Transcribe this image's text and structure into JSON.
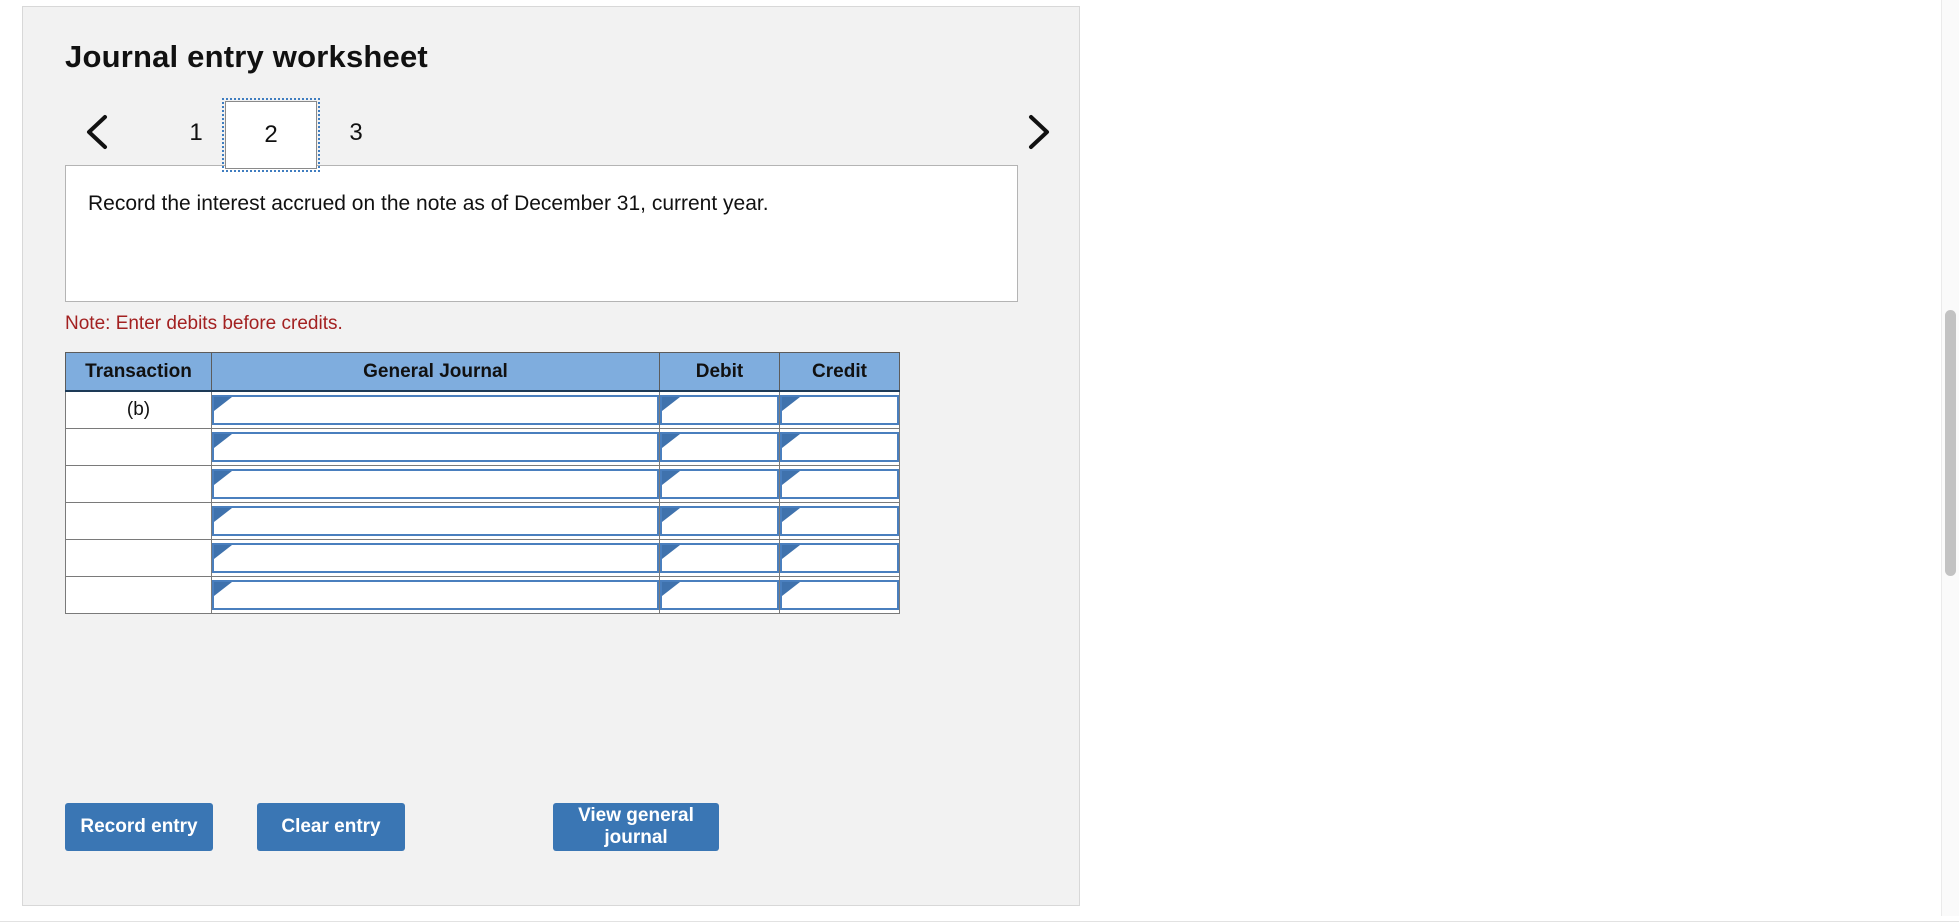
{
  "worksheet": {
    "title": "Journal entry worksheet",
    "description": "Record the interest accrued on the note as of December 31, current year.",
    "note": "Note: Enter debits before credits."
  },
  "pager": {
    "prev_icon": "chevron-left-icon",
    "next_icon": "chevron-right-icon",
    "tabs": [
      {
        "label": "1",
        "selected": false
      },
      {
        "label": "2",
        "selected": true
      },
      {
        "label": "3",
        "selected": false
      }
    ]
  },
  "table": {
    "headers": {
      "transaction": "Transaction",
      "general_journal": "General Journal",
      "debit": "Debit",
      "credit": "Credit"
    },
    "rows": [
      {
        "transaction": "(b)",
        "general_journal": "",
        "debit": "",
        "credit": ""
      },
      {
        "transaction": "",
        "general_journal": "",
        "debit": "",
        "credit": ""
      },
      {
        "transaction": "",
        "general_journal": "",
        "debit": "",
        "credit": ""
      },
      {
        "transaction": "",
        "general_journal": "",
        "debit": "",
        "credit": ""
      },
      {
        "transaction": "",
        "general_journal": "",
        "debit": "",
        "credit": ""
      },
      {
        "transaction": "",
        "general_journal": "",
        "debit": "",
        "credit": ""
      }
    ]
  },
  "actions": {
    "record_entry": "Record entry",
    "clear_entry": "Clear entry",
    "view_general_journal": "View general journal"
  },
  "colors": {
    "header_blue": "#7fadde",
    "button_blue": "#3a76b4",
    "note_red": "#a32121",
    "panel_gray": "#f2f2f2",
    "field_border_blue": "#4a7fbe"
  }
}
